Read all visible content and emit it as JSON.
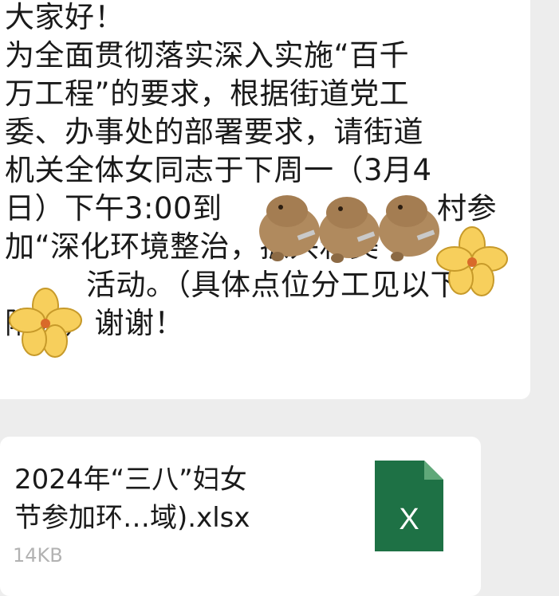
{
  "message": {
    "lines": [
      "大家好！",
      "为全面贯彻落实深入实施“百千",
      "万工程”的要求，根据街道党工",
      "委、办事处的部署要求，请街道",
      "机关全体女同志于下周一（3月4",
      "日）下午3:00到",
      "加“深化环境整治，振兴和美",
      "活动。（具体点位分工见以下",
      "附表）谢谢！"
    ],
    "line6_tail": "村参"
  },
  "file": {
    "name_line1": "2024年“三八”妇女",
    "name_line2": "节参加环…域).xlsx",
    "size": "14KB",
    "icon_letter": "X",
    "icon": "excel-file-icon"
  },
  "stickers": [
    "capybara-sticker",
    "flower-sticker"
  ],
  "colors": {
    "background": "#ededed",
    "bubble": "#ffffff",
    "text": "#1a1a1a",
    "excel_green": "#1e7145",
    "flower_yellow": "#f7cf5c"
  }
}
